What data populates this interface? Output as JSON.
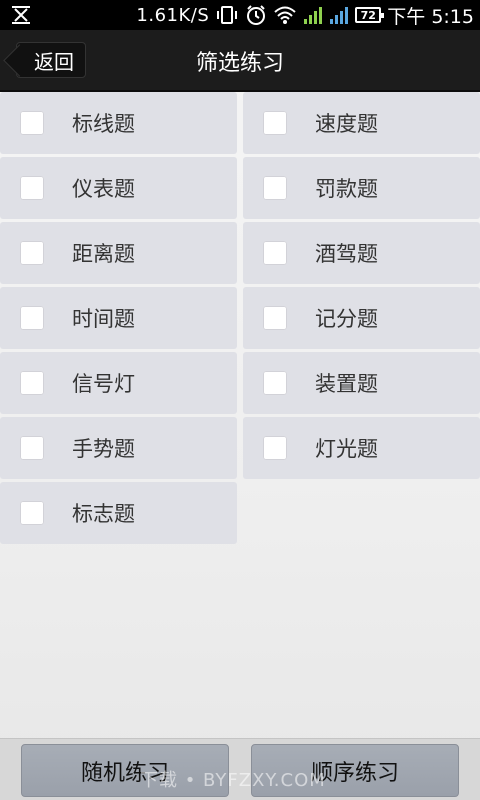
{
  "status_bar": {
    "network_speed": "1.61K/S",
    "battery_level": "72",
    "time": "下午 5:15",
    "icons": [
      "app-notification-icon",
      "vibrate-icon",
      "alarm-icon",
      "wifi-icon",
      "signal-icon",
      "signal-icon-2",
      "battery-icon"
    ]
  },
  "title_bar": {
    "back_label": "返回",
    "title": "筛选练习"
  },
  "options": [
    {
      "label": "标线题",
      "checked": false
    },
    {
      "label": "速度题",
      "checked": false
    },
    {
      "label": "仪表题",
      "checked": false
    },
    {
      "label": "罚款题",
      "checked": false
    },
    {
      "label": "距离题",
      "checked": false
    },
    {
      "label": "酒驾题",
      "checked": false
    },
    {
      "label": "时间题",
      "checked": false
    },
    {
      "label": "记分题",
      "checked": false
    },
    {
      "label": "信号灯",
      "checked": false
    },
    {
      "label": "装置题",
      "checked": false
    },
    {
      "label": "手势题",
      "checked": false
    },
    {
      "label": "灯光题",
      "checked": false
    },
    {
      "label": "标志题",
      "checked": false
    }
  ],
  "bottom_bar": {
    "random_label": "随机练习",
    "sequence_label": "顺序练习",
    "watermark": "下载 • BYFZXY.COM"
  },
  "colors": {
    "title_bar": "#1c1c1c",
    "option_bg": "#dfe0e6",
    "button_bg": "#a1a7b0"
  }
}
